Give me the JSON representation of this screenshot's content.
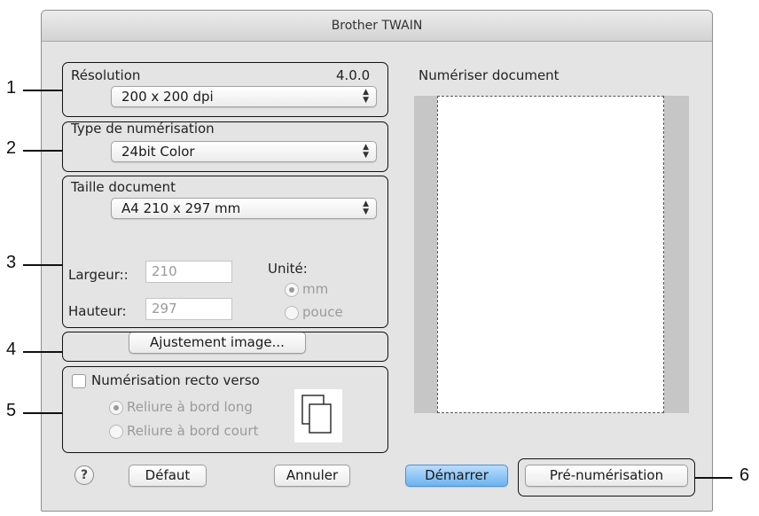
{
  "window": {
    "title": "Brother TWAIN"
  },
  "resolution": {
    "label": "Résolution",
    "version": "4.0.0",
    "value": "200 x 200 dpi"
  },
  "scan_type": {
    "label": "Type de numérisation",
    "value": "24bit Color"
  },
  "document_size": {
    "label": "Taille document",
    "value": "A4  210 x 297 mm",
    "width_label": "Largeur::",
    "width_value": "210",
    "height_label": "Hauteur:",
    "height_value": "297",
    "unit_label": "Unité:",
    "unit_options": [
      "mm",
      "pouce"
    ],
    "unit_selected": "mm"
  },
  "image_adjust": {
    "label": "Ajustement image..."
  },
  "duplex": {
    "label": "Numérisation recto verso",
    "checked": false,
    "options": [
      "Reliure à bord long",
      "Reliure à bord court"
    ],
    "selected": "Reliure à bord long"
  },
  "preview": {
    "title": "Numériser document"
  },
  "buttons": {
    "help": "?",
    "default": "Défaut",
    "cancel": "Annuler",
    "start": "Démarrer",
    "prescan": "Pré-numérisation"
  },
  "callouts": [
    "1",
    "2",
    "3",
    "4",
    "5",
    "6"
  ],
  "colors": {
    "primary_button": "#6db3f2",
    "window_bg": "#e4e4e4",
    "preview_frame": "#c6c6c6"
  }
}
